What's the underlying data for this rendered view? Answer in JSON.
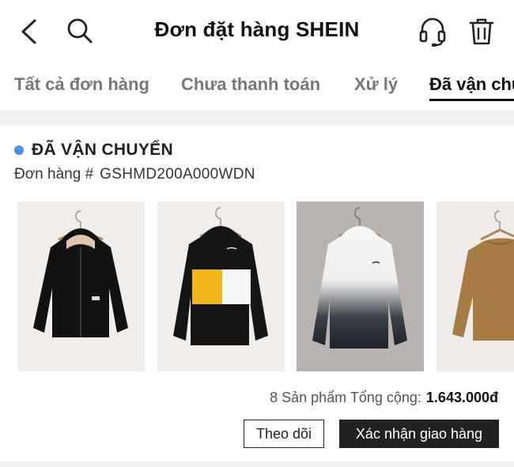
{
  "header": {
    "title": "Đơn đặt hàng SHEIN",
    "back_icon": "chevron-left-icon",
    "search_icon": "search-icon",
    "support_icon": "headset-icon",
    "trash_icon": "trash-icon"
  },
  "tabs": [
    {
      "label": "Tất cả đơn hàng",
      "active": false
    },
    {
      "label": "Chưa thanh toán",
      "active": false
    },
    {
      "label": "Xử lý",
      "active": false
    },
    {
      "label": "Đã vận chuyển",
      "active": true
    }
  ],
  "order": {
    "status": "ĐÃ VẬN CHUYỂN",
    "status_color": "#4a90e2",
    "number_label": "Đơn hàng #",
    "number": "GSHMD200A000WDN",
    "products": [
      {
        "name": "Black zip hoodie"
      },
      {
        "name": "Black yellow white colorblock hoodie"
      },
      {
        "name": "White black ombre hoodie"
      },
      {
        "name": "Brown sweatshirt"
      }
    ],
    "summary_prefix": "8 Sản phẩm Tổng cộng:",
    "total": "1.643.000đ",
    "track_button": "Theo dõi",
    "confirm_button": "Xác nhận giao hàng"
  }
}
